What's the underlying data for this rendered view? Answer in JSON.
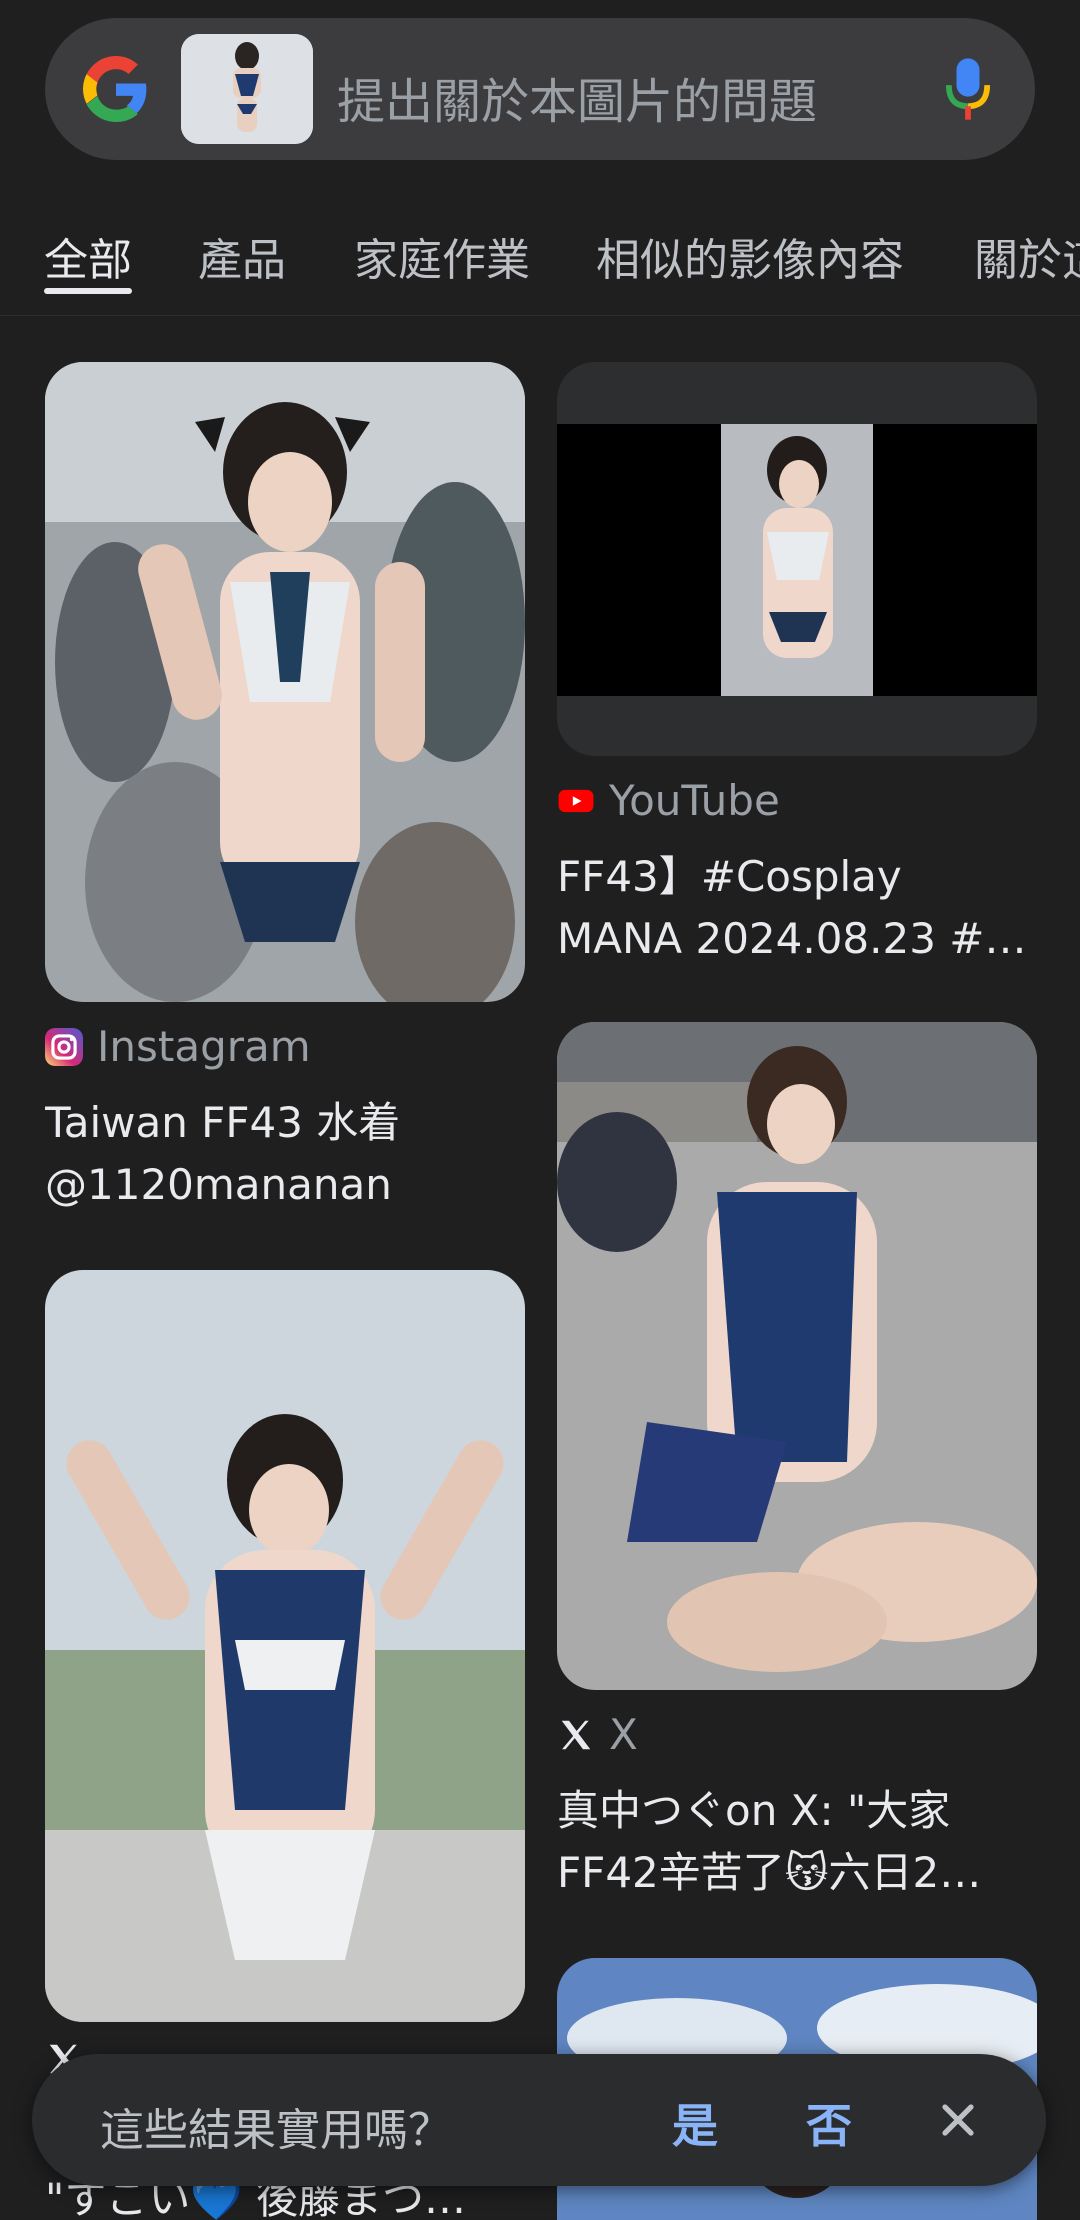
{
  "search": {
    "placeholder": "提出關於本圖片的問題",
    "logo_icon": "google-g-icon",
    "mic_icon": "mic-icon"
  },
  "tabs": [
    {
      "label": "全部",
      "active": true
    },
    {
      "label": "產品"
    },
    {
      "label": "家庭作業"
    },
    {
      "label": "相似的影像內容"
    },
    {
      "label": "關於這"
    }
  ],
  "results": [
    {
      "source": "Instagram",
      "source_icon": "instagram-icon",
      "title_lines": [
        "Taiwan FF43 水着",
        "@1120mananan"
      ]
    },
    {
      "source": "YouTube",
      "source_icon": "youtube-icon",
      "title_lines": [
        "FF43】#Cosplay",
        "MANA 2024.08.23 #…"
      ]
    },
    {
      "source": "X",
      "source_icon": "x-icon",
      "title_lines": [
        "真中つぐon X: \"大家",
        "FF42辛苦了😽六日2…"
      ]
    },
    {
      "source": "",
      "source_icon": "x-icon",
      "title_lines": [
        "\"すごい💙 後藤まつ…"
      ]
    }
  ],
  "feedback": {
    "question": "這些結果實用嗎？",
    "yes": "是",
    "no": "否",
    "close_icon": "close-icon"
  },
  "colors": {
    "background": "#1f1f20",
    "search_bar": "#3c3c3e",
    "accent_blue": "#8ab4f8"
  }
}
